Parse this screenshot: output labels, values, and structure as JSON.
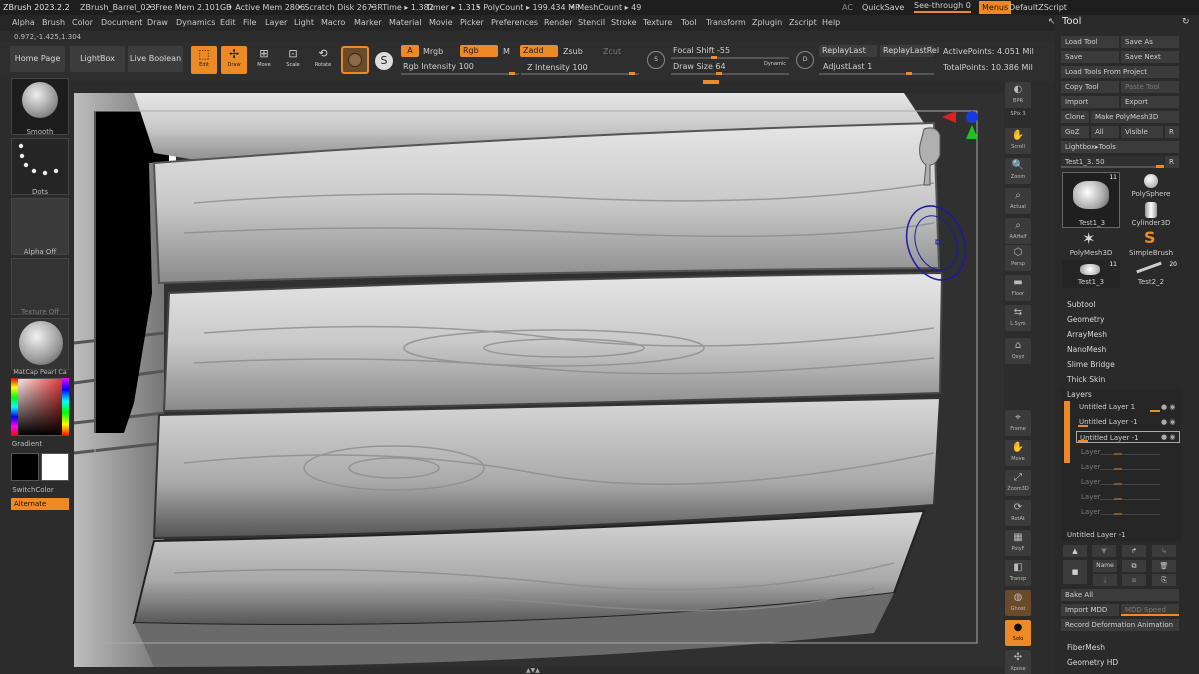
{
  "titlebar": {
    "app": "ZBrush 2023.2.2",
    "file": "ZBrush_Barrel_023",
    "free_mem": "• Free Mem 2.101GB",
    "active_mem": "• Active Mem 2806",
    "scratch": "• Scratch Disk 2673",
    "rtime": "• RTime ▸ 1.382",
    "timer": "Timer ▸ 1.315",
    "polycount": "• PolyCount ▸ 199.434 MP",
    "meshcount": "• MeshCount ▸ 49",
    "ac": "AC",
    "quicksave": "QuickSave",
    "seethrough": "See-through  0",
    "menus": "Menus",
    "zscript": "DefaultZScript"
  },
  "menubar": [
    "Alpha",
    "Brush",
    "Color",
    "Document",
    "Draw",
    "Dynamics",
    "Edit",
    "File",
    "Layer",
    "Light",
    "Macro",
    "Marker",
    "Material",
    "Movie",
    "Picker",
    "Preferences",
    "Render",
    "Stencil",
    "Stroke",
    "Texture",
    "Tool",
    "Transform",
    "Zplugin",
    "Zscript",
    "Help"
  ],
  "coords": "0.972,-1.425,1.304",
  "shelf": {
    "home_page": "Home Page",
    "lightbox": "LightBox",
    "live_boolean": "Live Boolean",
    "edit": "Edit",
    "draw": "Draw",
    "move": "Move",
    "scale": "Scale",
    "rotate": "Rotate",
    "a": "A",
    "mrgb": "Mrgb",
    "rgb": "Rgb",
    "m": "M",
    "zadd": "Zadd",
    "zsub": "Zsub",
    "zcut": "Zcut",
    "rgb_intensity_label": "Rgb Intensity 100",
    "z_intensity_label": "Z Intensity 100",
    "rgb_intensity": 100,
    "z_intensity": 100,
    "focal_shift_label": "Focal Shift -55",
    "draw_size_label": "Draw Size 64",
    "dynamic": "Dynamic",
    "replay_last": "ReplayLast",
    "replay_last_rel": "ReplayLastRel",
    "adjust_last": "AdjustLast 1",
    "active_points": "ActivePoints: 4.051 Mil",
    "total_points": "TotalPoints: 10.386 Mil"
  },
  "leftpanel": {
    "smooth": "Smooth",
    "dots": "Dots",
    "alpha_off": "Alpha Off",
    "texture_off": "Texture Off",
    "matcap": "MatCap Pearl Ca",
    "gradient": "Gradient",
    "switch_color": "SwitchColor",
    "alternate": "Alternate"
  },
  "rightstrip": [
    "BPR",
    "SPix 3",
    "Scroll",
    "Zoom",
    "Actual",
    "AAHalf",
    "Persp",
    "Floor",
    "L.Sym",
    "Qxyz",
    "Frame",
    "Move",
    "Zoom3D",
    "RotAt",
    "PolyF",
    "Transp",
    "Ghost",
    "Solo",
    "Xpose"
  ],
  "toolpanel": {
    "title": "Tool",
    "load_tool": "Load Tool",
    "save_as": "Save As",
    "save": "Save",
    "save_next": "Save Next",
    "load_from_project": "Load Tools From Project",
    "copy_tool": "Copy Tool",
    "paste_tool": "Paste Tool",
    "import": "Import",
    "export": "Export",
    "clone": "Clone",
    "make_polymesh": "Make PolyMesh3D",
    "goz": "GoZ",
    "all": "All",
    "visible": "Visible",
    "r": "R",
    "lightbox_tools": "Lightbox▸Tools",
    "current_tool": "Test1_3. 50",
    "tools": [
      {
        "name": "Test1_3",
        "count": "11"
      },
      {
        "name": "PolySphere",
        "count": ""
      },
      {
        "name": "Cylinder3D",
        "count": ""
      },
      {
        "name": "PolyMesh3D",
        "count": ""
      },
      {
        "name": "SimpleBrush",
        "count": ""
      },
      {
        "name": "Test1_3",
        "count": "11"
      },
      {
        "name": "Test2_2",
        "count": "20"
      }
    ],
    "sections": [
      "Subtool",
      "Geometry",
      "ArrayMesh",
      "NanoMesh",
      "Slime Bridge",
      "Thick Skin"
    ],
    "layers_title": "Layers",
    "layers": [
      "Untitled Layer 1",
      "Untitled Layer -1",
      "Untitled Layer -1"
    ],
    "empty_layers": [
      "Layer",
      "Layer",
      "Layer",
      "Layer",
      "Layer"
    ],
    "selected_layer": "Untitled Layer -1",
    "name_btn": "Name",
    "bake_all": "Bake All",
    "import_mdd": "Import MDD",
    "mdd_speed": "MDD Speed",
    "record_deformation": "Record Deformation Animation",
    "fibermesh": "FiberMesh",
    "geometry_hd": "Geometry HD"
  }
}
